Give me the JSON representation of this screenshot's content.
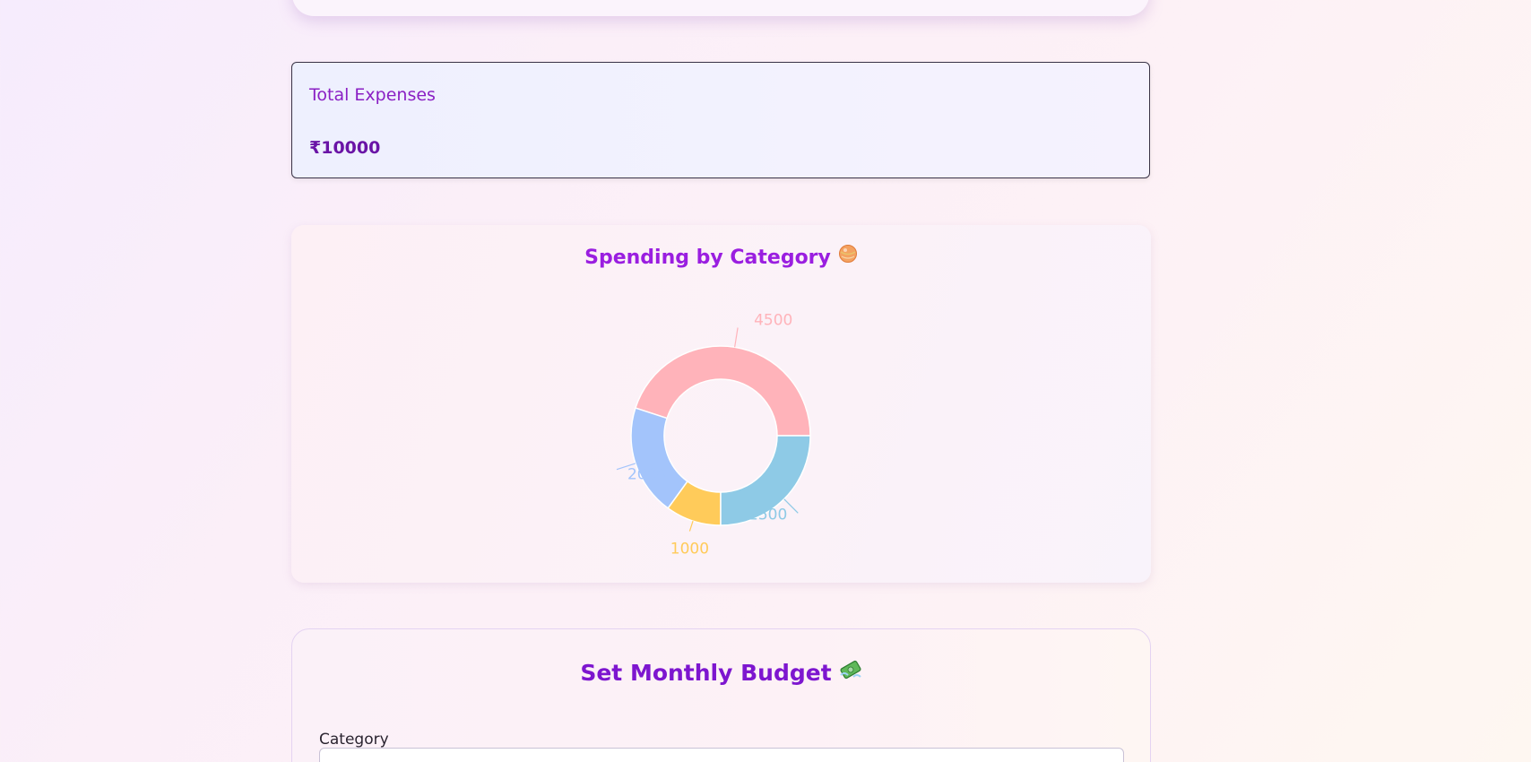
{
  "summary": {
    "total_label": "Total Expenses",
    "total_value": "₹10000"
  },
  "spending_chart": {
    "title": "Spending by Category",
    "title_icon": "orange-ball-icon",
    "chart_data": {
      "type": "pie",
      "variant": "donut",
      "values": [
        4500,
        2000,
        1000,
        2500
      ],
      "labels": [
        "4500",
        "2000",
        "1000",
        "2500"
      ],
      "colors": [
        "#ffb3ba",
        "#a3c4fb",
        "#ffcb5a",
        "#8ecae6"
      ],
      "start": "3 o'clock, counter-clockwise"
    }
  },
  "budget": {
    "title": "Set Monthly Budget",
    "title_icon": "money-with-wings-icon",
    "category_label": "Category"
  }
}
